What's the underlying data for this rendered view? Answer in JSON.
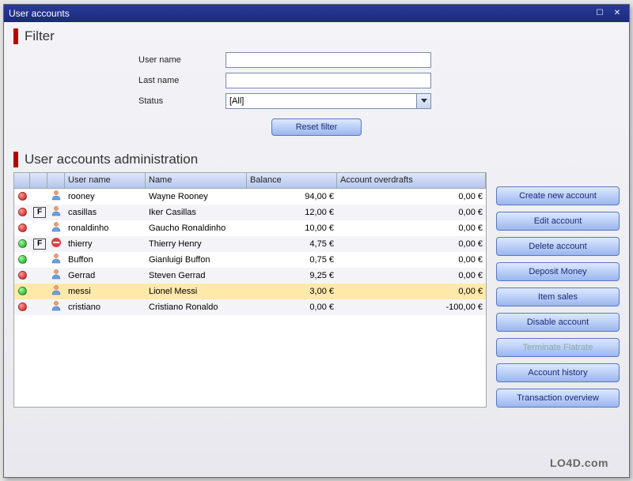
{
  "window": {
    "title": "User accounts"
  },
  "filter": {
    "heading": "Filter",
    "username_label": "User name",
    "lastname_label": "Last name",
    "status_label": "Status",
    "status_value": "[All]",
    "reset_label": "Reset filter",
    "username_value": "",
    "lastname_value": ""
  },
  "admin": {
    "heading": "User accounts administration",
    "columns": {
      "username": "User name",
      "name": "Name",
      "balance": "Balance",
      "overdraft": "Account overdrafts"
    },
    "rows": [
      {
        "status": "red",
        "flag": "",
        "extra": "",
        "user": "rooney",
        "name": "Wayne Rooney",
        "balance": "94,00 €",
        "overdraft": "0,00 €",
        "selected": false
      },
      {
        "status": "red",
        "flag": "F",
        "extra": "",
        "user": "casillas",
        "name": "Iker Casillas",
        "balance": "12,00 €",
        "overdraft": "0,00 €",
        "selected": false
      },
      {
        "status": "red",
        "flag": "",
        "extra": "",
        "user": "ronaldinho",
        "name": "Gaucho Ronaldinho",
        "balance": "10,00 €",
        "overdraft": "0,00 €",
        "selected": false
      },
      {
        "status": "green",
        "flag": "F",
        "extra": "lock",
        "user": "thierry",
        "name": "Thierry Henry",
        "balance": "4,75 €",
        "overdraft": "0,00 €",
        "selected": false
      },
      {
        "status": "green",
        "flag": "",
        "extra": "",
        "user": "Buffon",
        "name": "Gianluigi Buffon",
        "balance": "0,75 €",
        "overdraft": "0,00 €",
        "selected": false
      },
      {
        "status": "red",
        "flag": "",
        "extra": "",
        "user": "Gerrad",
        "name": "Steven Gerrad",
        "balance": "9,25 €",
        "overdraft": "0,00 €",
        "selected": false
      },
      {
        "status": "green",
        "flag": "",
        "extra": "",
        "user": "messi",
        "name": "Lionel Messi",
        "balance": "3,00 €",
        "overdraft": "0,00 €",
        "selected": true
      },
      {
        "status": "red",
        "flag": "",
        "extra": "",
        "user": "cristiano",
        "name": "Cristiano Ronaldo",
        "balance": "0,00 €",
        "overdraft": "-100,00 €",
        "selected": false
      }
    ]
  },
  "buttons": {
    "create": "Create new  account",
    "edit": "Edit account",
    "delete": "Delete account",
    "deposit": "Deposit Money",
    "items": "Item sales",
    "disable": "Disable account",
    "terminate": "Terminate Flatrate",
    "history": "Account history",
    "transactions": "Transaction overview"
  },
  "watermark": "LO4D.com"
}
